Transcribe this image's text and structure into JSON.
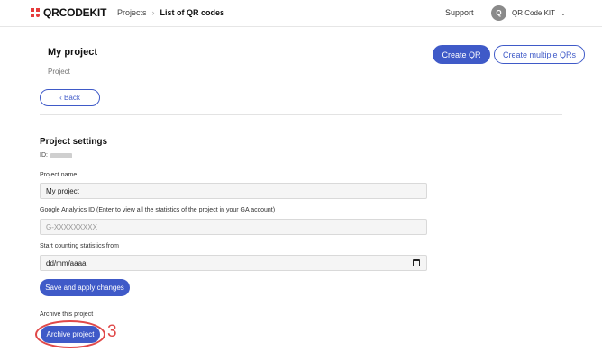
{
  "app": {
    "logo_text": "QRCODEKIT"
  },
  "breadcrumb": {
    "link": "Projects",
    "separator": "›",
    "current": "List of QR codes"
  },
  "header_right": {
    "support": "Support",
    "avatar_initial": "Q",
    "user_name": "QR Code KIT"
  },
  "project": {
    "title": "My project",
    "subtitle": "Project"
  },
  "buttons": {
    "create_qr": "Create QR",
    "create_multiple": "Create multiple QRs",
    "back": "‹ Back",
    "save": "Save and apply changes",
    "archive": "Archive project"
  },
  "settings": {
    "title": "Project settings",
    "id_label": "ID:",
    "project_name_label": "Project name",
    "project_name_value": "My project",
    "ga_label": "Google Analytics ID (Enter to view all the statistics of the project in your GA account)",
    "ga_placeholder": "G-XXXXXXXXX",
    "start_label": "Start counting statistics from",
    "start_value": "dd/mm/aaaa",
    "archive_label": "Archive this project"
  },
  "annotation": {
    "number": "3"
  },
  "colors": {
    "accent": "#3f5ac8",
    "logo": "#e63b3b",
    "annotation": "#e04848"
  },
  "icons": [
    "logo-icon",
    "chevron-down-icon",
    "calendar-icon"
  ]
}
